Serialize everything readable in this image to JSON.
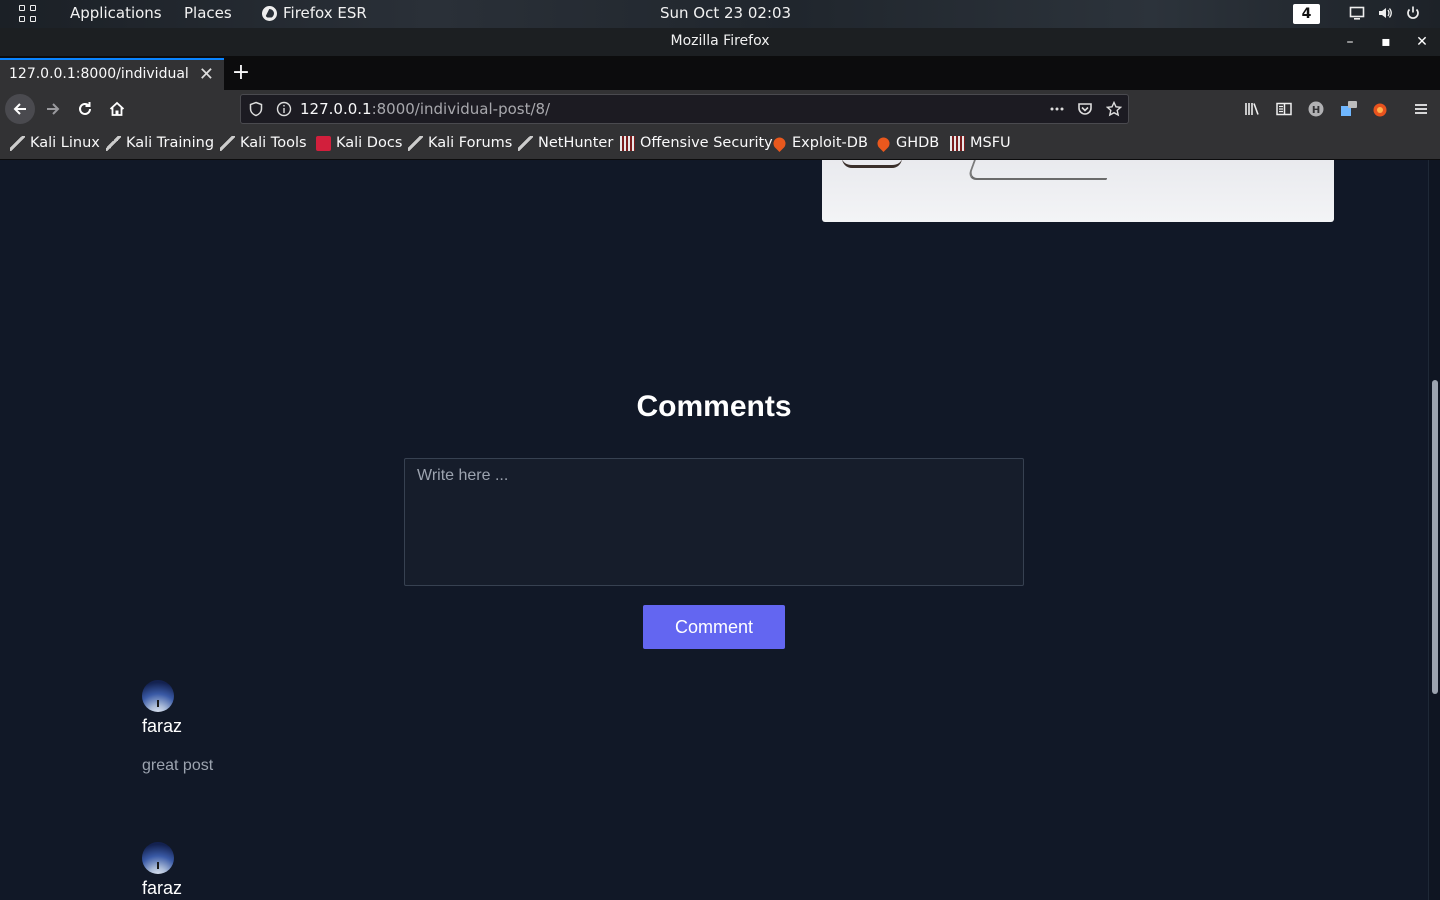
{
  "panel": {
    "applications": "Applications",
    "places": "Places",
    "active_app": "Firefox ESR",
    "clock": "Sun Oct 23  02:03",
    "workspace": "4"
  },
  "window": {
    "title": "Mozilla Firefox",
    "minimize": "–",
    "maximize": "▪",
    "close": "✕"
  },
  "tabs": [
    {
      "title": "127.0.0.1:8000/individual-post/8/",
      "close": "✕"
    }
  ],
  "new_tab": "+",
  "urlbar": {
    "host": "127.0.0.1",
    "path": ":8000/individual-post/8/"
  },
  "bookmarks": [
    {
      "label": "Kali Linux",
      "icon": "kali-dragon-icon"
    },
    {
      "label": "Kali Training",
      "icon": "kali-dragon-icon"
    },
    {
      "label": "Kali Tools",
      "icon": "kali-dragon-icon"
    },
    {
      "label": "Kali Docs",
      "icon": "kali-docs-icon"
    },
    {
      "label": "Kali Forums",
      "icon": "kali-dragon-icon"
    },
    {
      "label": "NetHunter",
      "icon": "kali-dragon-icon"
    },
    {
      "label": "Offensive Security",
      "icon": "offsec-icon"
    },
    {
      "label": "Exploit-DB",
      "icon": "exploit-db-icon"
    },
    {
      "label": "GHDB",
      "icon": "exploit-db-icon"
    },
    {
      "label": "MSFU",
      "icon": "offsec-icon"
    }
  ],
  "page": {
    "comments_heading": "Comments",
    "comment_placeholder": "Write here ...",
    "comment_button": "Comment",
    "comments": [
      {
        "author": "faraz",
        "text": "great post"
      },
      {
        "author": "faraz",
        "text": ""
      }
    ]
  },
  "colors": {
    "page_bg": "#111827",
    "button": "#6366f1",
    "accent_tab": "#0a84ff"
  }
}
